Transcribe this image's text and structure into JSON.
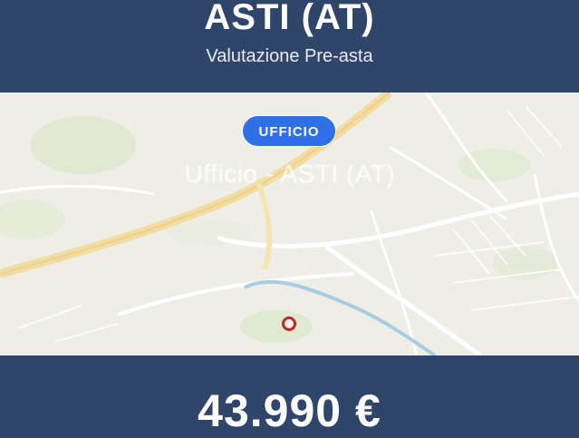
{
  "header": {
    "title": "ASTI (AT)",
    "subtitle": "Valutazione Pre-asta"
  },
  "map": {
    "category_badge": "UFFICIO",
    "location_label": "Ufficio - ASTI (AT)",
    "pin_icon": "location-pin-icon"
  },
  "listing": {
    "price": "43.990 €"
  },
  "colors": {
    "header_background": "#30456a",
    "badge_background": "#2f6fe8",
    "pin_color": "#c8242e",
    "map_background": "#efeee6"
  }
}
